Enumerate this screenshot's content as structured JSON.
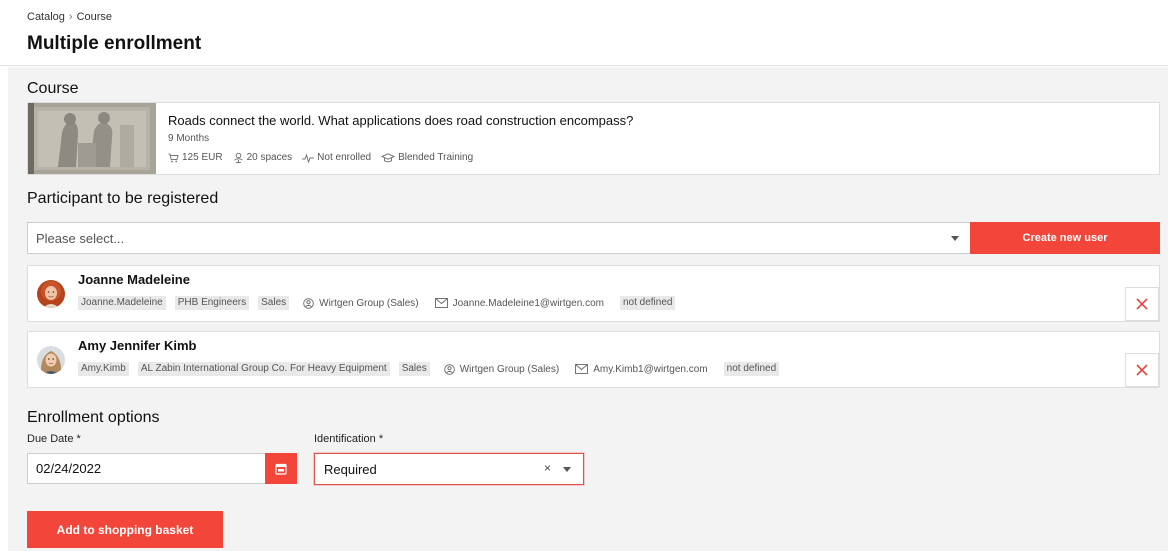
{
  "breadcrumb": {
    "items": [
      "Catalog",
      "Course"
    ],
    "separator": "›"
  },
  "page": {
    "title": "Multiple enrollment"
  },
  "course_section": {
    "title": "Course",
    "course": {
      "title": "Roads connect the world. What applications does road construction encompass?",
      "duration": "9 Months",
      "price": "125 EUR",
      "spaces": "20 spaces",
      "status": "Not enrolled",
      "type": "Blended Training"
    }
  },
  "participants_section": {
    "title": "Participant to be registered",
    "select_placeholder": "Please select...",
    "create_user_label": "Create new user",
    "participants": [
      {
        "name": "Joanne Madeleine",
        "username": "Joanne.Madeleine",
        "company": "PHB Engineers",
        "department": "Sales",
        "group": "Wirtgen Group (Sales)",
        "email": "Joanne.Madeleine1@wirtgen.com",
        "extra": "not defined"
      },
      {
        "name": "Amy Jennifer Kimb",
        "username": "Amy.Kimb",
        "company": "AL Zabin International Group Co. For Heavy Equipment",
        "department": "Sales",
        "group": "Wirtgen Group (Sales)",
        "email": "Amy.Kimb1@wirtgen.com",
        "extra": "not defined"
      }
    ]
  },
  "enrollment_section": {
    "title": "Enrollment options",
    "due_date_label": "Due Date *",
    "due_date_value": "02/24/2022",
    "identification_label": "Identification *",
    "identification_value": "Required",
    "clear_symbol": "×",
    "submit_label": "Add to shopping basket"
  },
  "colors": {
    "accent": "#f2463b",
    "background": "#f3f3f3"
  }
}
